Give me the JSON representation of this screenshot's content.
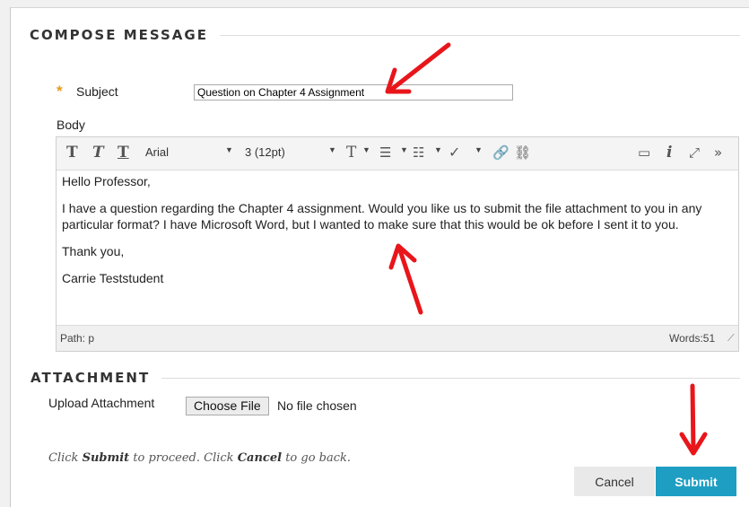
{
  "compose": {
    "heading": "COMPOSE MESSAGE",
    "required_mark": "*",
    "subject_label": "Subject",
    "subject_value": "Question on Chapter 4 Assignment",
    "body_label": "Body"
  },
  "editor": {
    "font_family": "Arial",
    "font_size": "3 (12pt)",
    "paragraphs": [
      "Hello Professor,",
      "I have a question regarding the Chapter 4 assignment.  Would you like us to submit the file attachment to you in any particular format?  I have Microsoft Word, but I wanted to make sure that this would be ok before I sent it to you.",
      "Thank you,",
      "Carrie Teststudent"
    ],
    "path_label": "Path: p",
    "word_count": "Words:51"
  },
  "attachment": {
    "heading": "ATTACHMENT",
    "upload_label": "Upload Attachment",
    "choose_file_label": "Choose File",
    "no_file_text": "No file chosen"
  },
  "footer": {
    "hint_prefix": "Click ",
    "hint_submit": "Submit",
    "hint_middle": " to proceed. Click ",
    "hint_cancel": "Cancel",
    "hint_suffix": " to go back.",
    "cancel_label": "Cancel",
    "submit_label": "Submit"
  },
  "colors": {
    "accent": "#1f9ec3",
    "required": "#e89a1c",
    "annotation_arrow": "#e8161b"
  }
}
